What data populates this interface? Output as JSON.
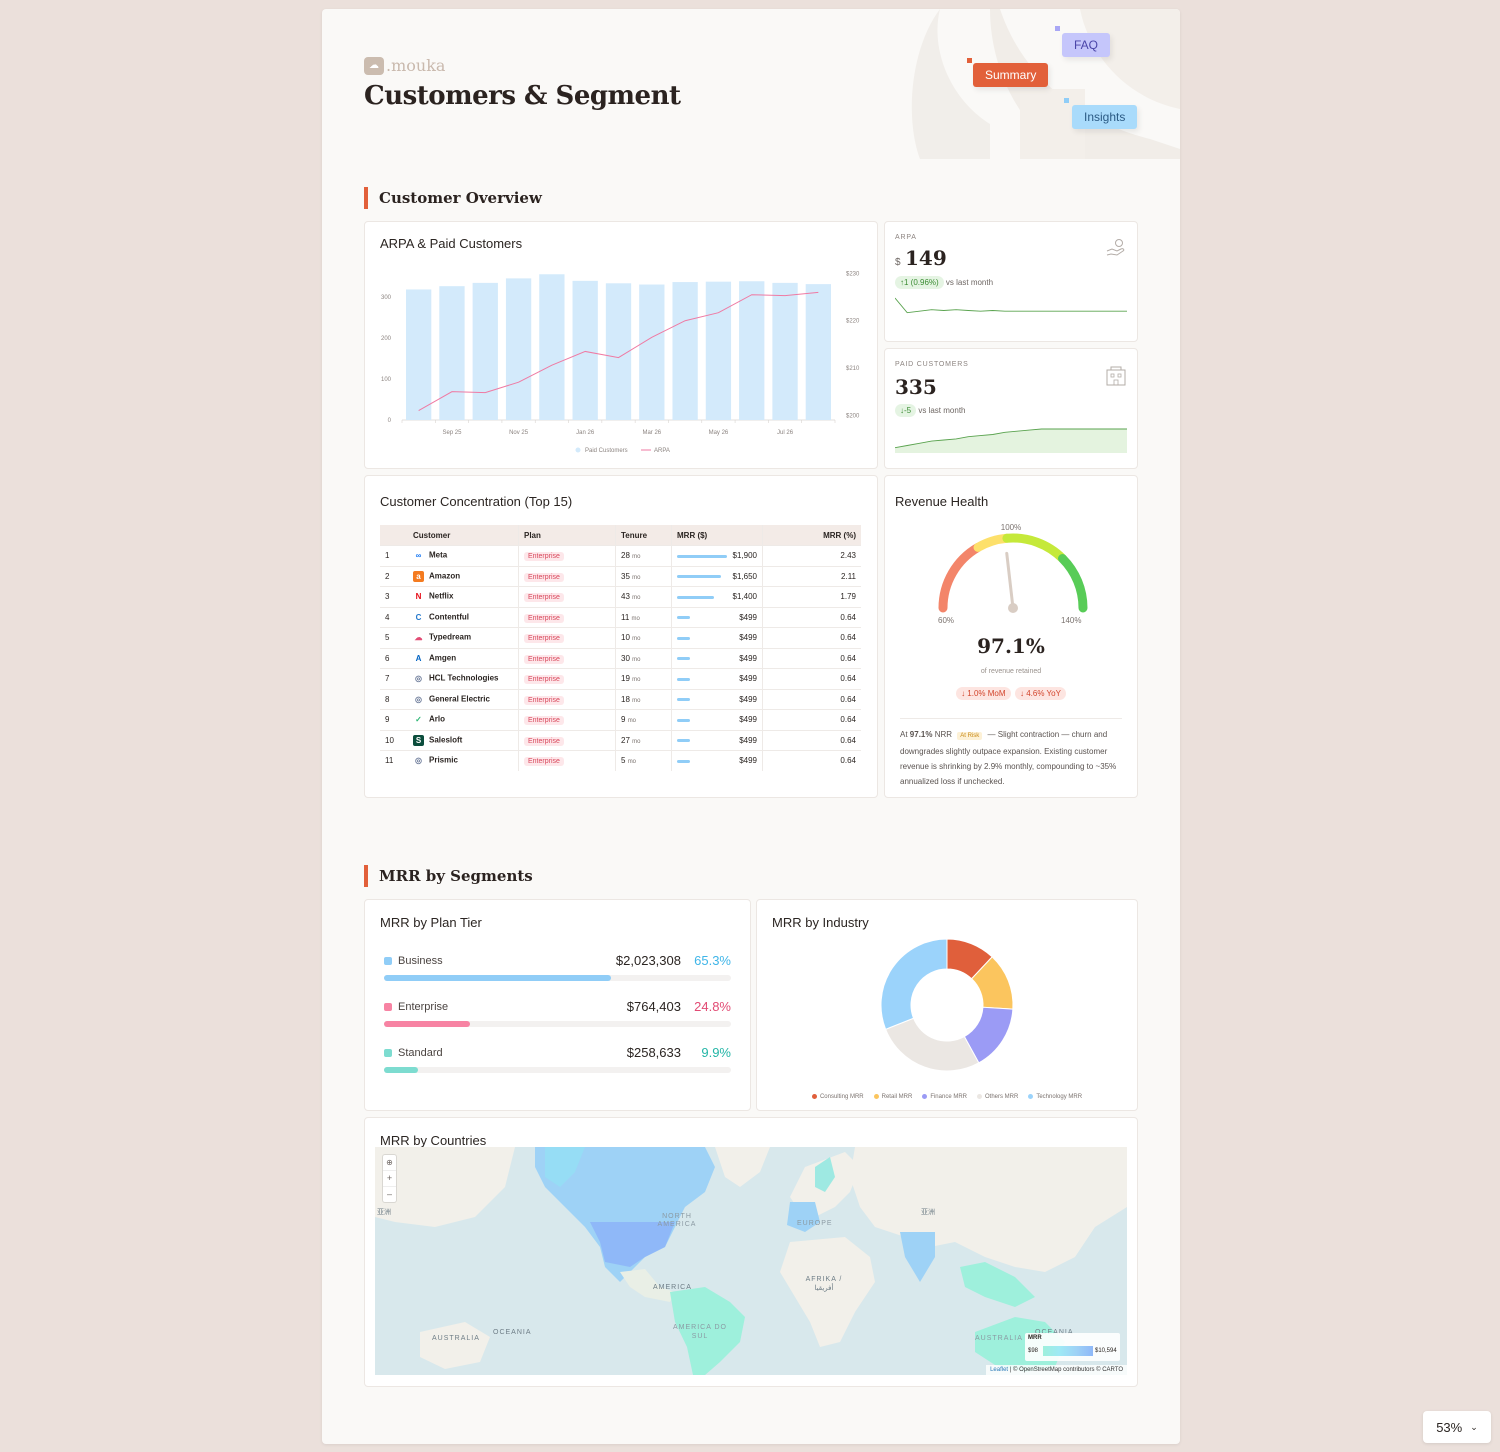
{
  "brand": {
    "logo_text": ".mouka"
  },
  "page": {
    "title": "Customers & Segment"
  },
  "tags": {
    "faq": "FAQ",
    "summary": "Summary",
    "insights": "Insights"
  },
  "sections": {
    "overview": "Customer Overview",
    "segments": "MRR by Segments"
  },
  "arpa_chart": {
    "title": "ARPA & Paid Customers",
    "chart_data": {
      "type": "bar",
      "categories": [
        "Aug 25",
        "Sep 25",
        "Oct 25",
        "Nov 25",
        "Dec 25",
        "Jan 26",
        "Feb 26",
        "Mar 26",
        "Apr 26",
        "May 26",
        "Jun 26",
        "Jul 26",
        "Aug 26"
      ],
      "tick_labels": [
        "Sep 25",
        "Nov 25",
        "Jan 26",
        "Mar 26",
        "May 26",
        "Jul 26"
      ],
      "series": [
        {
          "name": "Paid Customers",
          "type": "bar",
          "axis": "left",
          "color": "#d3eafb",
          "values": [
            318,
            326,
            334,
            345,
            355,
            339,
            333,
            330,
            336,
            337,
            338,
            334,
            331
          ]
        },
        {
          "name": "ARPA",
          "type": "line",
          "axis": "right",
          "color": "#ef7aa3",
          "values": [
            201,
            205,
            204.8,
            207,
            210.6,
            213.5,
            212.2,
            216.5,
            220,
            221.7,
            225.5,
            225.3,
            226
          ]
        }
      ],
      "y_left": {
        "ticks": [
          0,
          100,
          200,
          300
        ],
        "range": [
          0,
          380
        ]
      },
      "y_right": {
        "ticks": [
          "$200",
          "$210",
          "$220",
          "$230"
        ],
        "range": [
          199,
          232
        ]
      },
      "legend": [
        "Paid Customers",
        "ARPA"
      ]
    }
  },
  "kpi_arpa": {
    "label": "ARPA",
    "currency": "$",
    "value": "149",
    "delta": "↑1 (0.96%)",
    "delta_note": "vs last month",
    "sparkline": [
      30,
      10,
      12,
      14,
      13,
      14,
      13,
      12,
      13,
      12,
      12,
      12,
      12,
      12,
      12,
      12,
      12,
      12,
      12,
      12
    ]
  },
  "kpi_customers": {
    "label": "PAID CUSTOMERS",
    "value": "335",
    "delta": "↓-5",
    "delta_note": "vs last month",
    "sparkline": [
      3,
      5,
      7,
      9,
      10,
      11,
      13,
      14,
      15,
      17,
      18,
      19,
      20,
      20,
      20,
      20,
      20,
      20,
      20,
      20
    ]
  },
  "concentration": {
    "title": "Customer Concentration (Top 15)",
    "headers": [
      "Customer",
      "Plan",
      "Tenure",
      "MRR ($)",
      "MRR (%)"
    ],
    "rows": [
      {
        "rank": "1",
        "name": "Meta",
        "logo_icon": "meta-icon",
        "logo": "∞",
        "logo_bg": "#ffffff",
        "logo_fg": "#1877f2",
        "plan": "Enterprise",
        "tenure": "28",
        "unit": "mo",
        "mrr_fraction": 1.0,
        "mrr": "$1,900",
        "pct": "2.43"
      },
      {
        "rank": "2",
        "name": "Amazon",
        "logo_icon": "amazon-icon",
        "logo": "a",
        "logo_bg": "#f47b20",
        "logo_fg": "#ffffff",
        "plan": "Enterprise",
        "tenure": "35",
        "unit": "mo",
        "mrr_fraction": 0.87,
        "mrr": "$1,650",
        "pct": "2.11"
      },
      {
        "rank": "3",
        "name": "Netflix",
        "logo_icon": "netflix-icon",
        "logo": "N",
        "logo_bg": "#ffffff",
        "logo_fg": "#e50914",
        "plan": "Enterprise",
        "tenure": "43",
        "unit": "mo",
        "mrr_fraction": 0.74,
        "mrr": "$1,400",
        "pct": "1.79"
      },
      {
        "rank": "4",
        "name": "Contentful",
        "logo_icon": "contentful-icon",
        "logo": "C",
        "logo_bg": "#ffffff",
        "logo_fg": "#2478cc",
        "plan": "Enterprise",
        "tenure": "11",
        "unit": "mo",
        "mrr_fraction": 0.26,
        "mrr": "$499",
        "pct": "0.64"
      },
      {
        "rank": "5",
        "name": "Typedream",
        "logo_icon": "typedream-icon",
        "logo": "☁",
        "logo_bg": "#ffffff",
        "logo_fg": "#e24b74",
        "plan": "Enterprise",
        "tenure": "10",
        "unit": "mo",
        "mrr_fraction": 0.26,
        "mrr": "$499",
        "pct": "0.64"
      },
      {
        "rank": "6",
        "name": "Amgen",
        "logo_icon": "amgen-icon",
        "logo": "A",
        "logo_bg": "#ffffff",
        "logo_fg": "#0063c3",
        "plan": "Enterprise",
        "tenure": "30",
        "unit": "mo",
        "mrr_fraction": 0.26,
        "mrr": "$499",
        "pct": "0.64"
      },
      {
        "rank": "7",
        "name": "HCL Technologies",
        "logo_icon": "hcl-icon",
        "logo": "◎",
        "logo_bg": "#ffffff",
        "logo_fg": "#6b7a99",
        "plan": "Enterprise",
        "tenure": "19",
        "unit": "mo",
        "mrr_fraction": 0.26,
        "mrr": "$499",
        "pct": "0.64"
      },
      {
        "rank": "8",
        "name": "General Electric",
        "logo_icon": "ge-icon",
        "logo": "◎",
        "logo_bg": "#ffffff",
        "logo_fg": "#6b7a99",
        "plan": "Enterprise",
        "tenure": "18",
        "unit": "mo",
        "mrr_fraction": 0.26,
        "mrr": "$499",
        "pct": "0.64"
      },
      {
        "rank": "9",
        "name": "Arlo",
        "logo_icon": "arlo-icon",
        "logo": "✓",
        "logo_bg": "#ffffff",
        "logo_fg": "#2bb673",
        "plan": "Enterprise",
        "tenure": "9",
        "unit": "mo",
        "mrr_fraction": 0.26,
        "mrr": "$499",
        "pct": "0.64"
      },
      {
        "rank": "10",
        "name": "Salesloft",
        "logo_icon": "salesloft-icon",
        "logo": "S",
        "logo_bg": "#0b4d3c",
        "logo_fg": "#ffffff",
        "plan": "Enterprise",
        "tenure": "27",
        "unit": "mo",
        "mrr_fraction": 0.26,
        "mrr": "$499",
        "pct": "0.64"
      },
      {
        "rank": "11",
        "name": "Prismic",
        "logo_icon": "prismic-icon",
        "logo": "◎",
        "logo_bg": "#ffffff",
        "logo_fg": "#6b7a99",
        "plan": "Enterprise",
        "tenure": "5",
        "unit": "mo",
        "mrr_fraction": 0.26,
        "mrr": "$499",
        "pct": "0.64"
      }
    ]
  },
  "revenue_health": {
    "title": "Revenue Health",
    "gauge": {
      "min_label": "60%",
      "mid_label": "100%",
      "max_label": "140%",
      "min": 60,
      "max": 140,
      "value_num": 97.1
    },
    "value": "97.1%",
    "subtitle": "of revenue retained",
    "mom": "↓ 1.0% MoM",
    "yoy": "↓ 4.6% YoY",
    "note_prefix": "At",
    "note_value": "97.1%",
    "note_unit": "NRR",
    "note_badge": "At Risk",
    "note_text": "— Slight contraction — churn and downgrades slightly outpace expansion. Existing customer revenue is shrinking by 2.9% monthly, compounding to ~35% annualized loss if unchecked."
  },
  "plan_tier": {
    "title": "MRR by Plan Tier",
    "tiers": [
      {
        "name": "Business",
        "value": "$2,023,308",
        "pct": "65.3%",
        "fraction": 0.653,
        "color": "#90cdf7",
        "pct_color": "#3fb5e8"
      },
      {
        "name": "Enterprise",
        "value": "$764,403",
        "pct": "24.8%",
        "fraction": 0.248,
        "color": "#f783a3",
        "pct_color": "#e24b74"
      },
      {
        "name": "Standard",
        "value": "$258,633",
        "pct": "9.9%",
        "fraction": 0.099,
        "color": "#7ddcd0",
        "pct_color": "#23b5a6"
      }
    ]
  },
  "industry": {
    "title": "MRR by Industry",
    "chart_data": {
      "type": "pie",
      "series": [
        {
          "name": "Consulting MRR",
          "value": 12,
          "color": "#e05f3b"
        },
        {
          "name": "Retail MRR",
          "value": 14,
          "color": "#fbc55e"
        },
        {
          "name": "Finance MRR",
          "value": 16,
          "color": "#9b9bf5"
        },
        {
          "name": "Others MRR",
          "value": 27,
          "color": "#ebe7e3"
        },
        {
          "name": "Technology MRR",
          "value": 31,
          "color": "#9bd3fb"
        }
      ]
    }
  },
  "countries": {
    "title": "MRR by Countries",
    "map_labels": {
      "north_america": "NORTH AMERICA",
      "europe": "EUROPE",
      "africa": "AFRIKA / أفريقيا",
      "south_america": "AMERICA DO SUL",
      "america": "AMERICA",
      "australia_w": "AUSTRALIA",
      "oceania_w": "OCEANIA",
      "australia_e": "AUSTRALIA",
      "oceania_e": "OCEANIA",
      "asia_w": "亚洲",
      "asia_e": "亚洲"
    },
    "zoom_in": "+",
    "zoom_out": "–",
    "legend_title": "MRR",
    "legend_min": "$98",
    "legend_max": "$10,594",
    "attribution_leaflet": "Leaflet",
    "attribution_rest": "| © OpenStreetMap contributors © CARTO"
  },
  "zoom": {
    "value": "53%"
  }
}
